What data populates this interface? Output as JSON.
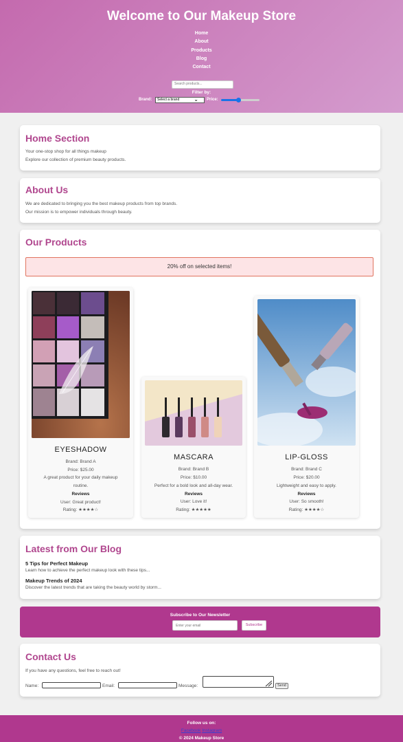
{
  "header": {
    "title": "Welcome to Our Makeup Store",
    "nav": [
      "Home",
      "About",
      "Products",
      "Blog",
      "Contact"
    ],
    "search_placeholder": "Search products...",
    "filter_title": "Filter by:",
    "brand_label": "Brand:",
    "brand_select": "Select a brand",
    "price_label": "Price:",
    "price_slider_level": 0.45
  },
  "home": {
    "title": "Home Section",
    "lines": [
      "Your one-stop shop for all things makeup",
      "Explore our collection of premium beauty products."
    ]
  },
  "about": {
    "title": "About Us",
    "lines": [
      "We are dedicated to bringing you the best makeup products from top brands.",
      "Our mission is to empower individuals through beauty."
    ]
  },
  "products": {
    "title": "Our Products",
    "promo": "20% off on selected items!",
    "items": [
      {
        "name": "EYESHADOW",
        "brand": "Brand: Brand A",
        "price": "Price: $25.00",
        "desc1": "A great product for your daily makeup",
        "desc2": "routine.",
        "reviews": "Reviews",
        "review": "User: Great product!",
        "rating": "Rating: ★★★★☆"
      },
      {
        "name": "MASCARA",
        "brand": "Brand: Brand B",
        "price": "Price: $10.00",
        "desc1": "Perfect for a bold look and all-day wear.",
        "reviews": "Reviews",
        "review": "User: Love it!",
        "rating": "Rating: ★★★★★"
      },
      {
        "name": "LIP-GLOSS",
        "brand": "Brand: Brand C",
        "price": "Price: $20.00",
        "desc1": "Lightweight and easy to apply.",
        "reviews": "Reviews",
        "review": "User: So smooth!",
        "rating": "Rating: ★★★★☆"
      }
    ]
  },
  "blog": {
    "title": "Latest from Our Blog",
    "posts": [
      {
        "title": "5 Tips for Perfect Makeup",
        "excerpt": "Learn how to achieve the perfect makeup look with these tips..."
      },
      {
        "title": "Makeup Trends of 2024",
        "excerpt": "Discover the latest trends that are taking the beauty world by storm..."
      }
    ]
  },
  "newsletter": {
    "title": "Subscribe to Our Newsletter",
    "email_placeholder": "Enter your email",
    "button": "Subscribe"
  },
  "contact": {
    "title": "Contact Us",
    "text": "If you have any questions, feel free to reach out!",
    "name_label": "Name:",
    "email_label": "Email:",
    "message_label": "Message:",
    "send": "Send"
  },
  "footer": {
    "follow": "Follow us on:",
    "links": [
      "Facebook",
      "Instagram"
    ],
    "copyright": "© 2024 Makeup Store"
  },
  "colors": {
    "header_gradient": [
      "#c46aae",
      "#d49cce"
    ],
    "accent": "#b0388e",
    "section_title": "#b0468e",
    "promo_bg": "#fde4e6",
    "promo_border": "#e0735e"
  }
}
